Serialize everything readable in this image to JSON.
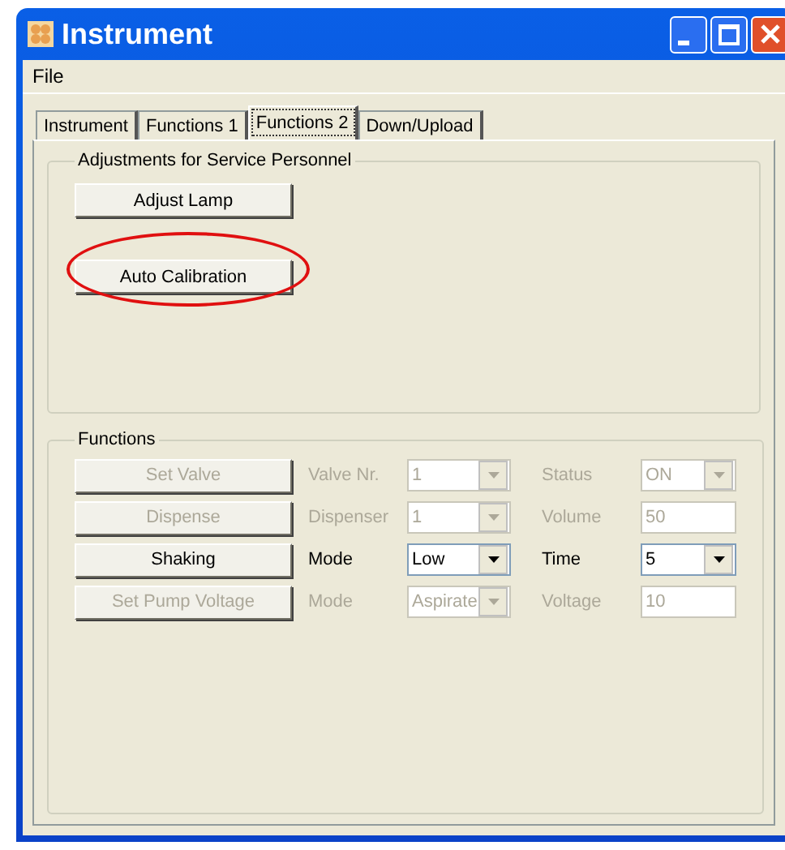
{
  "window": {
    "title": "Instrument"
  },
  "menu": [
    "File"
  ],
  "tabs": [
    {
      "label": "Instrument",
      "selected": false
    },
    {
      "label": "Functions 1",
      "selected": false
    },
    {
      "label": "Functions 2",
      "selected": true
    },
    {
      "label": "Down/Upload",
      "selected": false
    }
  ],
  "adjustments": {
    "title": "Adjustments for Service Personnel",
    "buttons": [
      {
        "label": "Adjust Lamp",
        "highlighted": false
      },
      {
        "label": "Auto Calibration",
        "highlighted": true
      }
    ]
  },
  "functions": {
    "title": "Functions",
    "rows": [
      {
        "button": "Set Valve",
        "disabled": true,
        "label_1": "Valve Nr.",
        "control_1": {
          "kind": "combo",
          "value": "1"
        },
        "label_2": "Status",
        "control_2": {
          "kind": "combo",
          "value": "ON"
        }
      },
      {
        "button": "Dispense",
        "disabled": true,
        "label_1": "Dispenser",
        "control_1": {
          "kind": "combo",
          "value": "1"
        },
        "label_2": "Volume",
        "control_2": {
          "kind": "text",
          "value": "50"
        }
      },
      {
        "button": "Shaking",
        "disabled": false,
        "label_1": "Mode",
        "control_1": {
          "kind": "combo",
          "value": "Low"
        },
        "label_2": "Time",
        "control_2": {
          "kind": "combo",
          "value": "5"
        }
      },
      {
        "button": "Set Pump Voltage",
        "disabled": true,
        "label_1": "Mode",
        "control_1": {
          "kind": "combo",
          "value": "Aspirate"
        },
        "label_2": "Voltage",
        "control_2": {
          "kind": "text",
          "value": "10"
        }
      }
    ]
  }
}
